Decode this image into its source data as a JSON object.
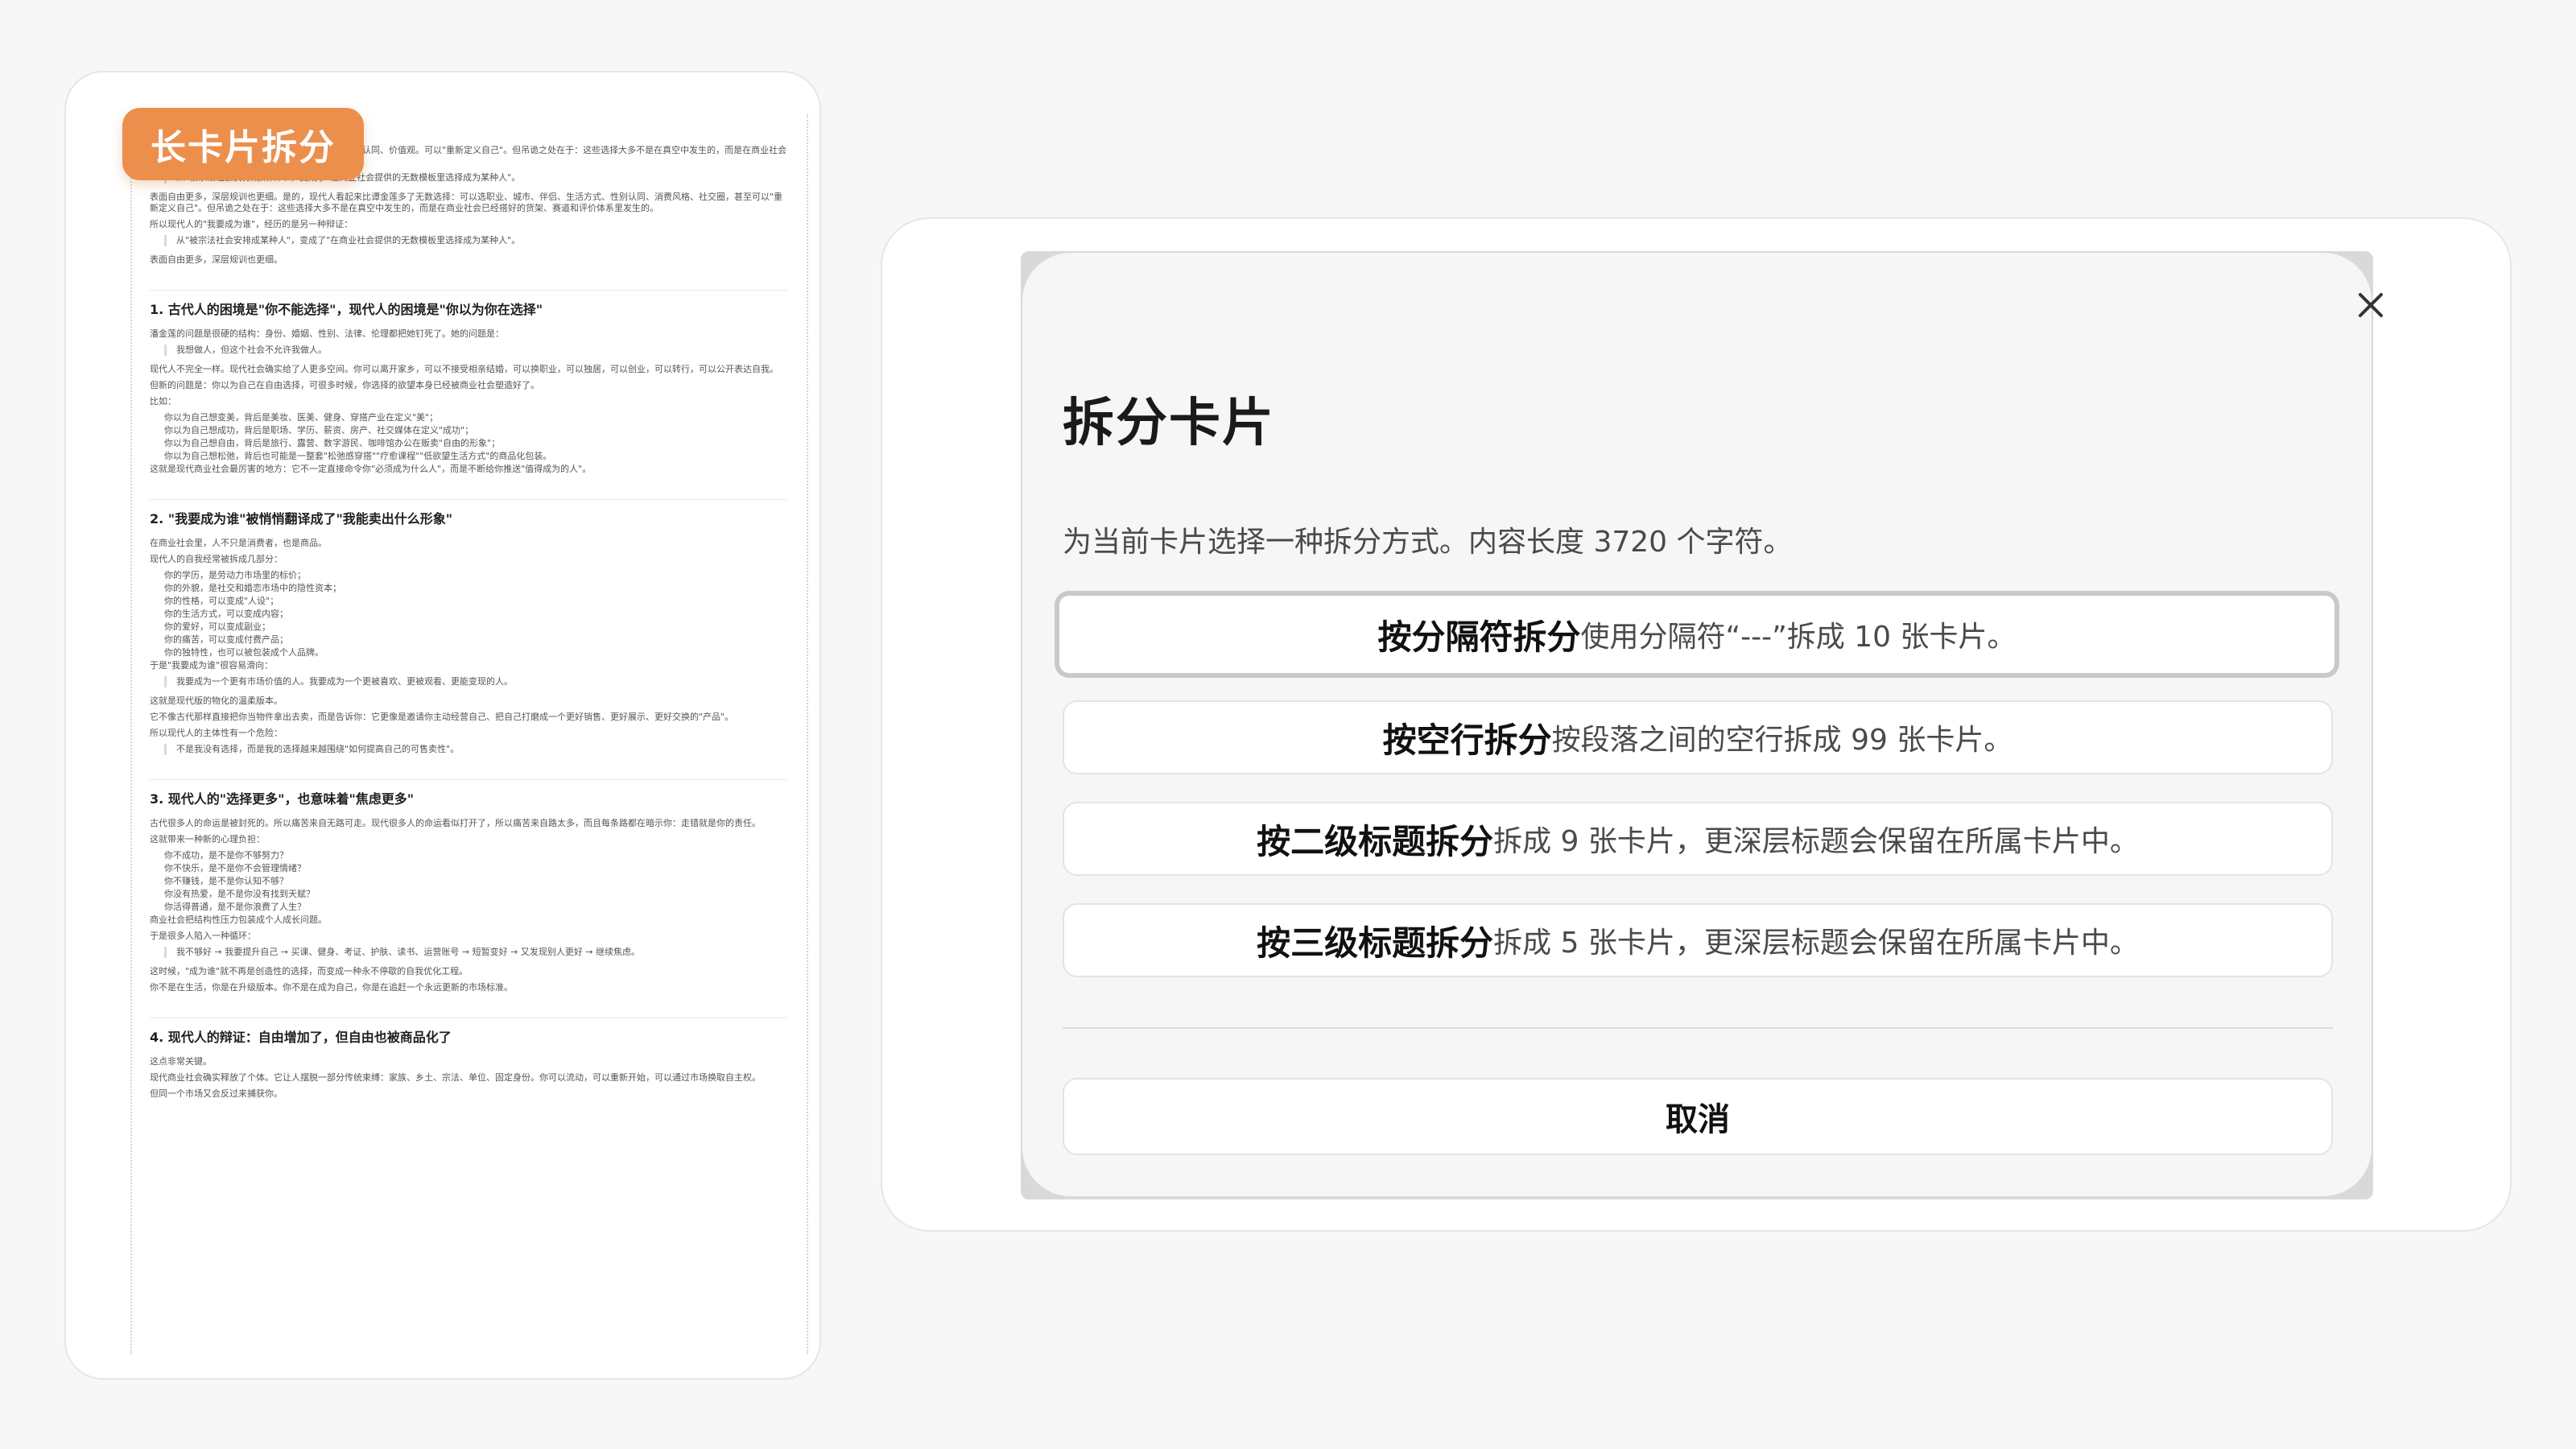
{
  "preview": {
    "badge_label": "长卡片拆分",
    "blocks": [
      {
        "type": "p",
        "text": "无数选择：可以选职业、城市、伴侣、生活方式、性别认同、价值观。可以\"重新定义自己\"。但吊诡之处在于：这些选择大多不是在真空中发生的，而是在商业社会已经搭好的货架、赛道和评价体系里发生的。"
      },
      {
        "type": "quote",
        "text": "从\"被宗法社会安排成某种人\"，变成了\"在商业社会提供的无数模板里选择成为某种人\"。"
      },
      {
        "type": "p",
        "text": "表面自由更多，深层规训也更细。是的，现代人看起来比谭金莲多了无数选择：可以选职业、城市、伴侣、生活方式、性别认同、消费风格、社交圈，甚至可以\"重新定义自己\"。但吊诡之处在于：这些选择大多不是在真空中发生的，而是在商业社会已经搭好的货架、赛道和评价体系里发生的。"
      },
      {
        "type": "p",
        "text": "所以现代人的\"我要成为谁\"，经历的是另一种辩证："
      },
      {
        "type": "quote",
        "text": "从\"被宗法社会安排成某种人\"，变成了\"在商业社会提供的无数模板里选择成为某种人\"。"
      },
      {
        "type": "p",
        "text": "表面自由更多，深层规训也更细。"
      },
      {
        "type": "h",
        "text": "1. 古代人的困境是\"你不能选择\"，现代人的困境是\"你以为你在选择\""
      },
      {
        "type": "p",
        "text": "潘金莲的问题是很硬的结构：身份、婚姻、性别、法律、伦理都把她钉死了。她的问题是："
      },
      {
        "type": "quote",
        "text": "我想做人，但这个社会不允许我做人。"
      },
      {
        "type": "p",
        "text": "现代人不完全一样。现代社会确实给了人更多空间。你可以离开家乡，可以不接受相亲结婚，可以换职业，可以独居，可以创业，可以转行，可以公开表达自我。"
      },
      {
        "type": "p",
        "text": "但新的问题是：你以为自己在自由选择，可很多时候，你选择的欲望本身已经被商业社会塑造好了。"
      },
      {
        "type": "p",
        "text": "比如："
      },
      {
        "type": "li",
        "text": "你以为自己想变美，背后是美妆、医美、健身、穿搭产业在定义\"美\"；"
      },
      {
        "type": "li",
        "text": "你以为自己想成功，背后是职场、学历、薪资、房产、社交媒体在定义\"成功\"；"
      },
      {
        "type": "li",
        "text": "你以为自己想自由，背后是旅行、露营、数字游民、咖啡馆办公在贩卖\"自由的形象\"；"
      },
      {
        "type": "li",
        "text": "你以为自己想松弛，背后也可能是一整套\"松弛感穿搭\"\"疗愈课程\"\"低欲望生活方式\"的商品化包装。"
      },
      {
        "type": "p",
        "text": "这就是现代商业社会最厉害的地方：它不一定直接命令你\"必须成为什么人\"，而是不断给你推送\"值得成为的人\"。"
      },
      {
        "type": "h",
        "text": "2. \"我要成为谁\"被悄悄翻译成了\"我能卖出什么形象\""
      },
      {
        "type": "p",
        "text": "在商业社会里，人不只是消费者，也是商品。"
      },
      {
        "type": "p",
        "text": "现代人的自我经常被拆成几部分："
      },
      {
        "type": "li",
        "text": "你的学历，是劳动力市场里的标价；"
      },
      {
        "type": "li",
        "text": "你的外貌，是社交和婚恋市场中的隐性资本；"
      },
      {
        "type": "li",
        "text": "你的性格，可以变成\"人设\"；"
      },
      {
        "type": "li",
        "text": "你的生活方式，可以变成内容；"
      },
      {
        "type": "li",
        "text": "你的爱好，可以变成副业；"
      },
      {
        "type": "li",
        "text": "你的痛苦，可以变成付费产品；"
      },
      {
        "type": "li",
        "text": "你的独特性，也可以被包装成个人品牌。"
      },
      {
        "type": "p",
        "text": "于是\"我要成为谁\"很容易滑向："
      },
      {
        "type": "quote",
        "text": "我要成为一个更有市场价值的人。我要成为一个更被喜欢、更被观看、更能变现的人。"
      },
      {
        "type": "p",
        "text": "这就是现代版的物化的温柔版本。"
      },
      {
        "type": "p",
        "text": "它不像古代那样直接把你当物件拿出去卖，而是告诉你：它更像是邀请你主动经营自己、把自己打磨成一个更好销售、更好展示、更好交换的\"产品\"。"
      },
      {
        "type": "p",
        "text": "所以现代人的主体性有一个危险："
      },
      {
        "type": "quote",
        "text": "不是我没有选择，而是我的选择越来越围绕\"如何提高自己的可售卖性\"。"
      },
      {
        "type": "h",
        "text": "3. 现代人的\"选择更多\"，也意味着\"焦虑更多\""
      },
      {
        "type": "p",
        "text": "古代很多人的命运是被封死的。所以痛苦来自无路可走。现代很多人的命运看似打开了，所以痛苦来自路太多，而且每条路都在暗示你：走错就是你的责任。"
      },
      {
        "type": "p",
        "text": "这就带来一种新的心理负担："
      },
      {
        "type": "li",
        "text": "你不成功，是不是你不够努力？"
      },
      {
        "type": "li",
        "text": "你不快乐，是不是你不会管理情绪？"
      },
      {
        "type": "li",
        "text": "你不赚钱，是不是你认知不够？"
      },
      {
        "type": "li",
        "text": "你没有热爱，是不是你没有找到天赋？"
      },
      {
        "type": "li",
        "text": "你活得普通，是不是你浪费了人生？"
      },
      {
        "type": "p",
        "text": "商业社会把结构性压力包装成个人成长问题。"
      },
      {
        "type": "p",
        "text": "于是很多人陷入一种循环："
      },
      {
        "type": "quote",
        "text": "我不够好 → 我要提升自己 → 买课、健身、考证、护肤、读书、运营账号 → 短暂变好 → 又发现别人更好 → 继续焦虑。"
      },
      {
        "type": "p",
        "text": "这时候，\"成为谁\"就不再是创造性的选择，而变成一种永不停歇的自我优化工程。"
      },
      {
        "type": "p",
        "text": "你不是在生活，你是在升级版本。你不是在成为自己，你是在追赶一个永远更新的市场标准。"
      },
      {
        "type": "h",
        "text": "4. 现代人的辩证：自由增加了，但自由也被商品化了"
      },
      {
        "type": "p",
        "text": "这点非常关键。"
      },
      {
        "type": "p",
        "text": "现代商业社会确实释放了个体。它让人摆脱一部分传统束缚：家族、乡土、宗法、单位、固定身份。你可以流动，可以重新开始，可以通过市场换取自主权。"
      },
      {
        "type": "p",
        "text": "但同一个市场又会反过来捕获你。"
      }
    ]
  },
  "dialog": {
    "title": "拆分卡片",
    "description": "为当前卡片选择一种拆分方式。内容长度 3720 个字符。",
    "options": [
      {
        "label": "按分隔符拆分",
        "hint": "使用分隔符“---”拆成 10 张卡片。"
      },
      {
        "label": "按空行拆分",
        "hint": "按段落之间的空行拆成 99 张卡片。"
      },
      {
        "label": "按二级标题拆分",
        "hint": "拆成 9 张卡片，更深层标题会保留在所属卡片中。"
      },
      {
        "label": "按三级标题拆分",
        "hint": "拆成 5 张卡片，更深层标题会保留在所属卡片中。"
      }
    ],
    "cancel_label": "取消",
    "close_icon": "close-icon"
  },
  "colors": {
    "badge": "#ec8f4c",
    "dialog_bg": "#f6f6f6",
    "selected_border": "#c9c9c9"
  }
}
